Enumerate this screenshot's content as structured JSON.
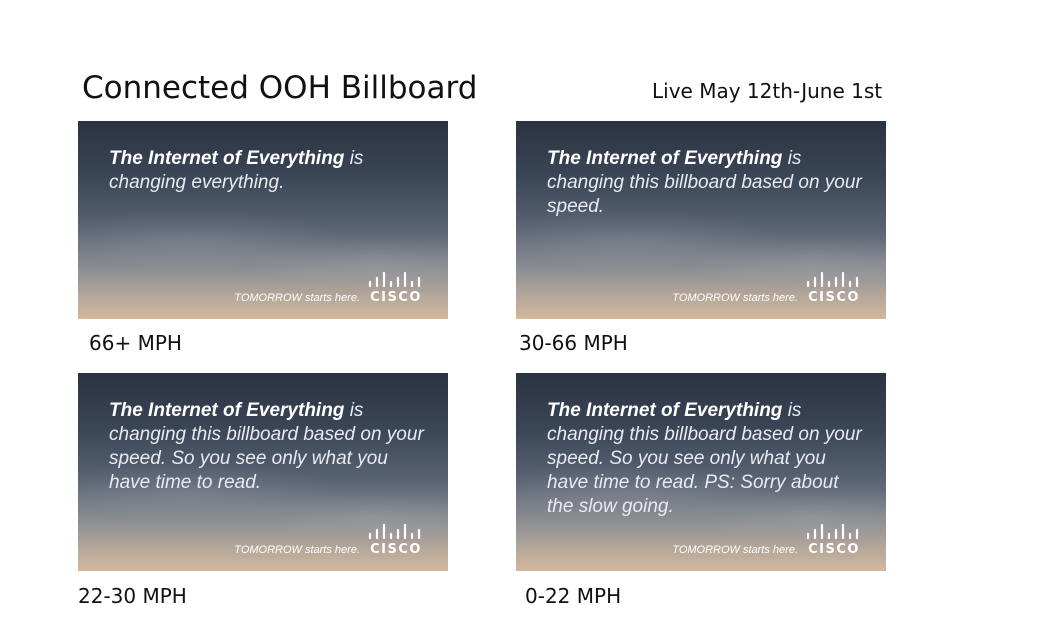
{
  "header": {
    "title": "Connected OOH Billboard",
    "live_dates": "Live May 12th-June 1st"
  },
  "common": {
    "brand_phrase": "The Internet of Everything",
    "tagline": "TOMORROW starts here.",
    "logo_word": "CISCO"
  },
  "billboards": [
    {
      "message_rest": " is changing everything.",
      "speed_label": "66+ MPH"
    },
    {
      "message_rest": " is changing this billboard based on your speed.",
      "speed_label": "30-66 MPH"
    },
    {
      "message_rest": " is changing this billboard based on your speed. So you see only what you have time to read.",
      "speed_label": "22-30 MPH"
    },
    {
      "message_rest": " is changing this billboard based on your speed. So you see only what you have time to read. PS: Sorry about the slow going.",
      "speed_label": "0-22 MPH"
    }
  ],
  "colors": {
    "sky_top": "#2a3341",
    "sky_bottom": "#d2b89d",
    "text": "#111111"
  }
}
